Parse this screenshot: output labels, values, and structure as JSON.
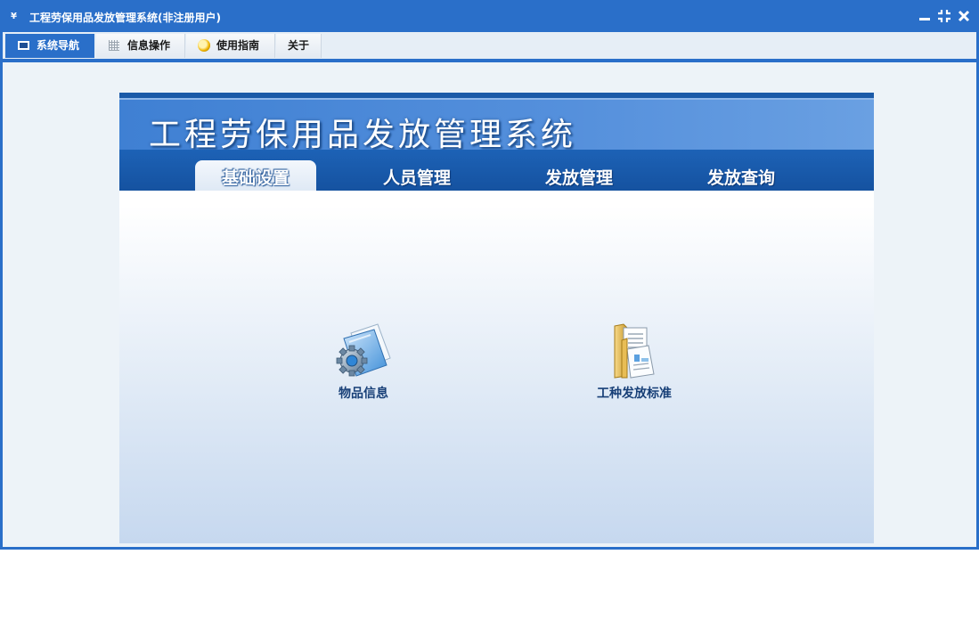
{
  "window": {
    "app_icon": "¥",
    "title": "工程劳保用品发放管理系统(非注册用户)",
    "controls": [
      "minimize-icon",
      "restore-icon",
      "close-icon"
    ]
  },
  "menubar": {
    "items": [
      {
        "label": "系统导航",
        "icon": "monitor-icon",
        "active": true
      },
      {
        "label": "信息操作",
        "icon": "grid-icon",
        "active": false
      },
      {
        "label": "使用指南",
        "icon": "help-bulb-icon",
        "active": false
      },
      {
        "label": "关于",
        "icon": "",
        "active": false
      }
    ]
  },
  "panel": {
    "title": "工程劳保用品发放管理系统",
    "tabs": [
      {
        "label": "基础设置",
        "active": true
      },
      {
        "label": "人员管理",
        "active": false
      },
      {
        "label": "发放管理",
        "active": false
      },
      {
        "label": "发放查询",
        "active": false
      }
    ],
    "tiles": [
      {
        "label": "物品信息",
        "icon": "settings-folder-icon"
      },
      {
        "label": "工种发放标准",
        "icon": "document-folder-icon"
      }
    ]
  },
  "colors": {
    "accent": "#2a6fc9",
    "banner": "#4a87d8",
    "tabbar": "#1b5aa8",
    "tile_label": "#173f77"
  }
}
